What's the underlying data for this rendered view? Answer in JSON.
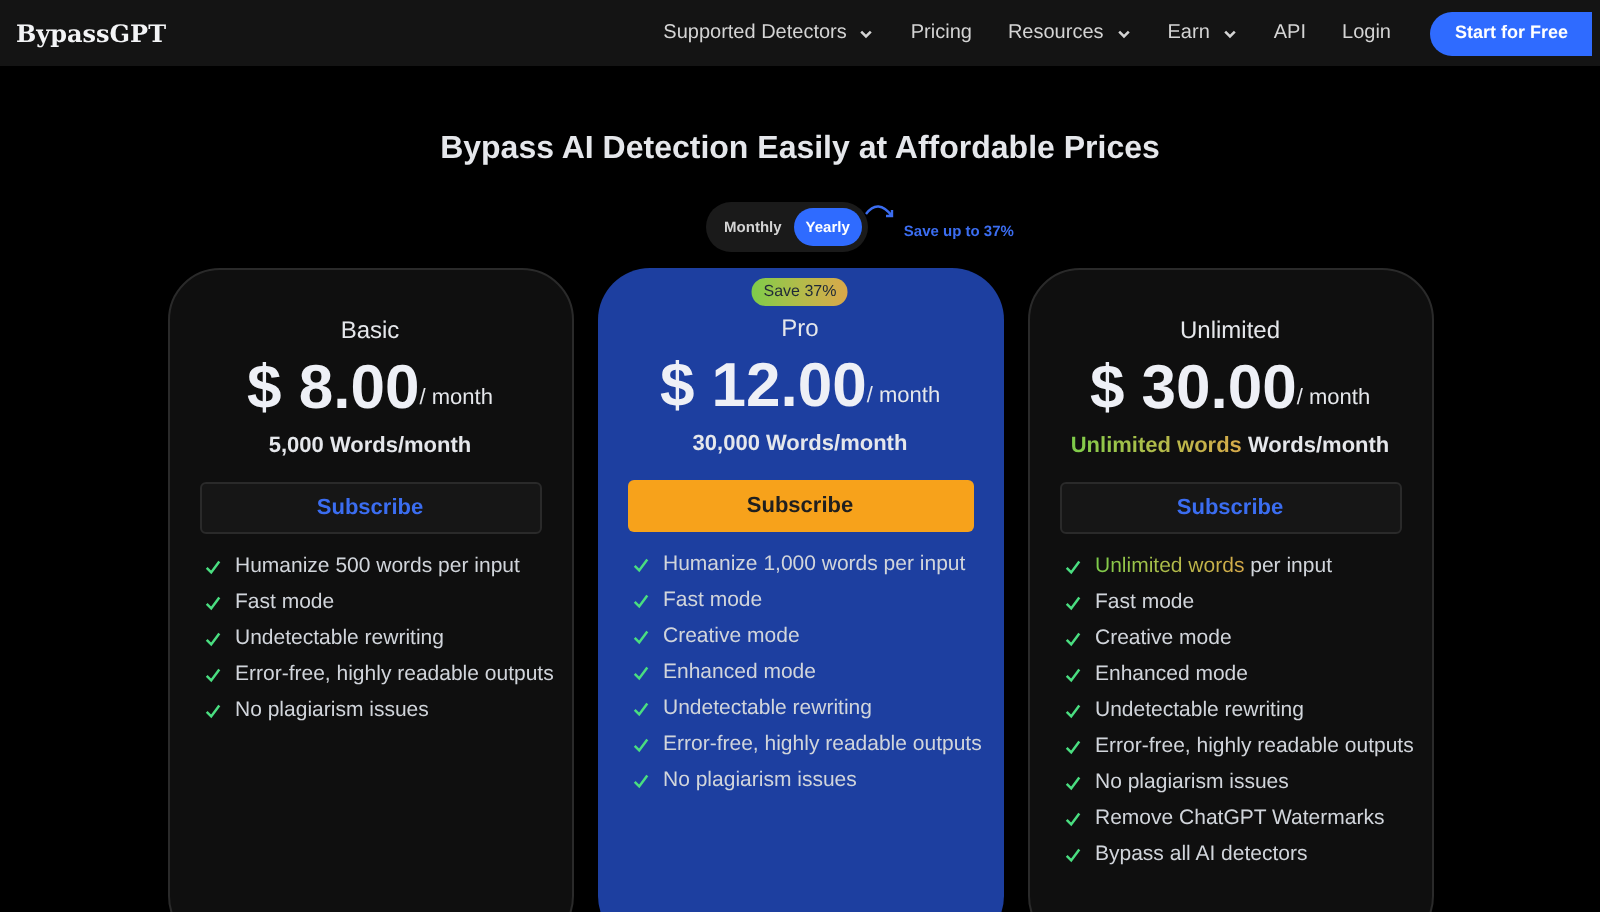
{
  "nav": {
    "logo": "BypassGPT",
    "items": [
      {
        "label": "Supported Detectors",
        "dropdown": true
      },
      {
        "label": "Pricing",
        "dropdown": false
      },
      {
        "label": "Resources",
        "dropdown": true
      },
      {
        "label": "Earn",
        "dropdown": true
      },
      {
        "label": "API",
        "dropdown": false
      },
      {
        "label": "Login",
        "dropdown": false
      }
    ],
    "cta": "Start for Free"
  },
  "heading": "Bypass AI Detection Easily at Affordable Prices",
  "billing": {
    "options": [
      {
        "label": "Monthly",
        "selected": false
      },
      {
        "label": "Yearly",
        "selected": true
      }
    ],
    "note": "Save up to 37%"
  },
  "plans": [
    {
      "kind": "standard",
      "name": "Basic",
      "price": "$ 8.00",
      "period": "/ month",
      "words": {
        "text": "5,000 Words/month"
      },
      "button": "Subscribe",
      "features": [
        {
          "text": "Humanize 500 words per input"
        },
        {
          "text": "Fast mode"
        },
        {
          "text": "Undetectable rewriting"
        },
        {
          "text": "Error-free, highly readable outputs"
        },
        {
          "text": "No plagiarism issues"
        }
      ]
    },
    {
      "kind": "featured",
      "badge": "Save 37%",
      "name": "Pro",
      "price": "$ 12.00",
      "period": "/ month",
      "words": {
        "text": "30,000 Words/month"
      },
      "button": "Subscribe",
      "features": [
        {
          "text": "Humanize 1,000 words per input"
        },
        {
          "text": "Fast mode"
        },
        {
          "text": "Creative mode"
        },
        {
          "text": "Enhanced mode"
        },
        {
          "text": "Undetectable rewriting"
        },
        {
          "text": "Error-free, highly readable outputs"
        },
        {
          "text": "No plagiarism issues"
        }
      ]
    },
    {
      "kind": "standard",
      "name": "Unlimited",
      "price": "$ 30.00",
      "period": "/ month",
      "words": {
        "highlight": "Unlimited words",
        "text": "Words/month"
      },
      "button": "Subscribe",
      "features": [
        {
          "highlight": "Unlimited words",
          "text": "per input"
        },
        {
          "text": "Fast mode"
        },
        {
          "text": "Creative mode"
        },
        {
          "text": "Enhanced mode"
        },
        {
          "text": "Undetectable rewriting"
        },
        {
          "text": "Error-free, highly readable outputs"
        },
        {
          "text": "No plagiarism issues"
        },
        {
          "text": "Remove ChatGPT Watermarks"
        },
        {
          "text": "Bypass all AI detectors"
        }
      ]
    }
  ]
}
